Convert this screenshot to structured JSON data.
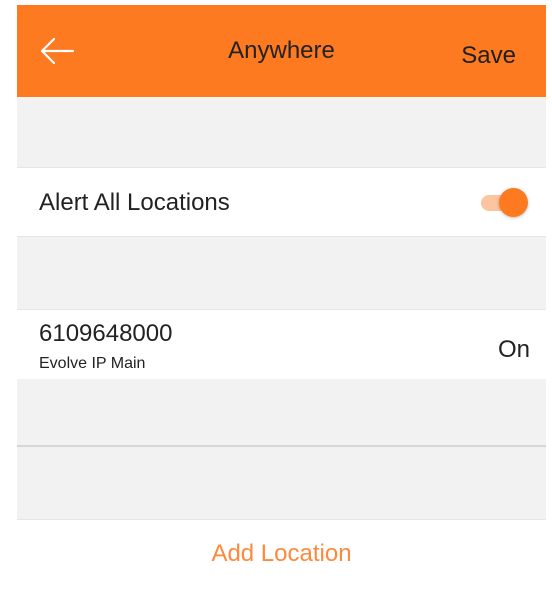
{
  "app_bar": {
    "title": "Anywhere",
    "save_label": "Save",
    "back_icon": "arrow-left-icon",
    "background": "#fd7a20"
  },
  "alert_all": {
    "label": "Alert All Locations",
    "toggle_on": true,
    "toggle_color": "#fd7a20"
  },
  "locations": [
    {
      "number": "6109648000",
      "name": "Evolve IP Main",
      "status": "On"
    }
  ],
  "add_location": {
    "label": "Add Location",
    "color": "#fd8a3c"
  }
}
